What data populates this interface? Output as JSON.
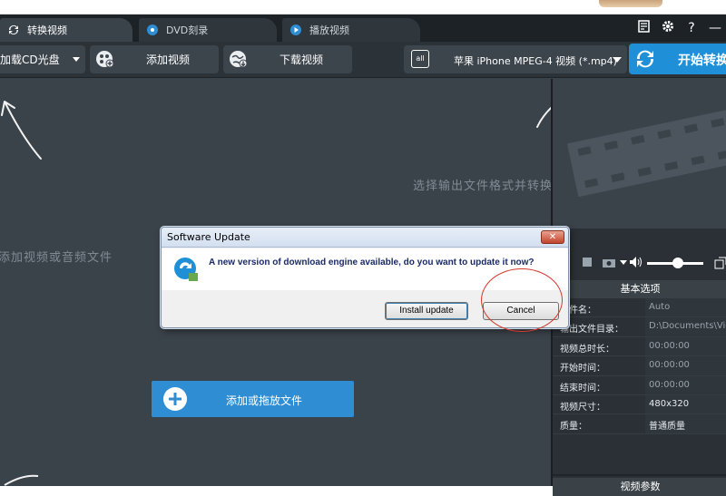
{
  "app": {
    "tabs": [
      {
        "label": "转换视频",
        "active": true
      },
      {
        "label": "DVD刻录",
        "active": false
      },
      {
        "label": "播放视频",
        "active": false
      }
    ],
    "window_controls": {
      "help": "?",
      "minimize": "—"
    }
  },
  "toolbar": {
    "load_cd_label": "加载CD光盘",
    "add_video_label": "添加视频",
    "download_video_label": "下载视频",
    "format_icon_text": "all",
    "format_value": "苹果 iPhone MPEG-4 视频 (*.mp4)",
    "start_convert_label": "开始转换"
  },
  "main": {
    "hint_left": "添加视频或音频文件",
    "hint_right": "选择输出文件格式并转换",
    "add_drop_label": "添加或拖放文件"
  },
  "properties": {
    "header": "基本选项",
    "rows": [
      {
        "key": "文件名：",
        "value": "Auto"
      },
      {
        "key": "输出文件目录：",
        "value": "D:\\Documents\\Vic"
      },
      {
        "key": "视频总时长：",
        "value": "00:00:00"
      },
      {
        "key": "开始时间：",
        "value": "00:00:00"
      },
      {
        "key": "结束时间：",
        "value": "00:00:00"
      },
      {
        "key": "视频尺寸：",
        "value": "480x320"
      },
      {
        "key": "质量：",
        "value": "普通质量"
      }
    ],
    "video_params_label": "视频参数"
  },
  "dialog": {
    "title": "Software Update",
    "close_label": "✕",
    "message": "A new version of download engine available, do you want to update it now?",
    "install_label": "Install update",
    "cancel_label": "Cancel"
  },
  "colors": {
    "accent": "#1f8fd8",
    "annotation": "#d43a2c"
  }
}
